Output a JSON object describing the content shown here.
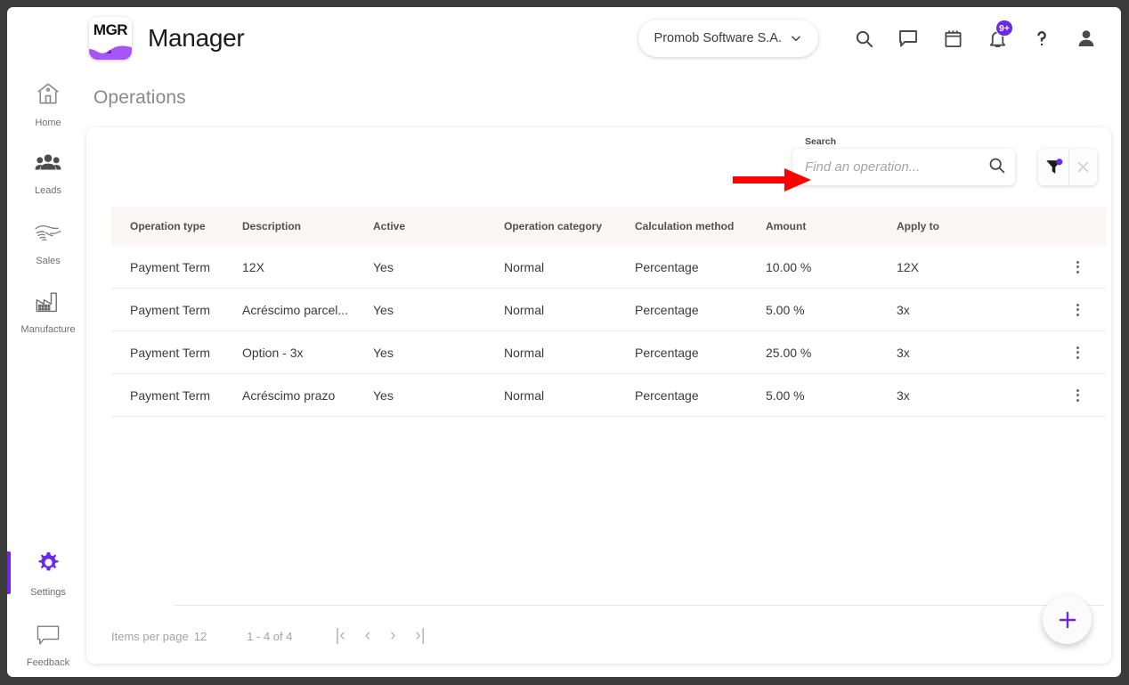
{
  "app": {
    "logo_text": "MGR",
    "title": "Manager"
  },
  "header": {
    "company": "Promob Software S.A.",
    "icons": [
      {
        "name": "search-icon",
        "label": "Search"
      },
      {
        "name": "chat-icon",
        "label": "Messages"
      },
      {
        "name": "calendar-icon",
        "label": "Calendar"
      },
      {
        "name": "bell-icon",
        "label": "Notifications",
        "badge": "9+"
      },
      {
        "name": "help-icon",
        "label": "Help"
      },
      {
        "name": "user-icon",
        "label": "Account"
      }
    ],
    "notification_badge": "9+"
  },
  "sidebar": {
    "items": [
      {
        "label": "Home",
        "icon": "home-icon",
        "active": false
      },
      {
        "label": "Leads",
        "icon": "people-icon",
        "active": false
      },
      {
        "label": "Sales",
        "icon": "handshake-icon",
        "active": false
      },
      {
        "label": "Manufacture",
        "icon": "factory-icon",
        "active": false
      },
      {
        "label": "Settings",
        "icon": "gear-icon",
        "active": true
      },
      {
        "label": "Feedback",
        "icon": "chat-bubble-icon",
        "active": false
      }
    ]
  },
  "page": {
    "title": "Operations"
  },
  "search": {
    "label": "Search",
    "placeholder": "Find an operation...",
    "value": ""
  },
  "filter": {
    "filter_icon": "funnel-icon",
    "has_active_filter": true,
    "clear_label": "×"
  },
  "table": {
    "columns": [
      "Operation type",
      "Description",
      "Active",
      "Operation category",
      "Calculation method",
      "Amount",
      "Apply to"
    ],
    "rows": [
      {
        "operation_type": "Payment Term",
        "description": "12X",
        "active": "Yes",
        "operation_category": "Normal",
        "calculation_method": "Percentage",
        "amount": "10.00 %",
        "apply_to": "12X"
      },
      {
        "operation_type": "Payment Term",
        "description": "Acréscimo parcel...",
        "active": "Yes",
        "operation_category": "Normal",
        "calculation_method": "Percentage",
        "amount": "5.00 %",
        "apply_to": "3x"
      },
      {
        "operation_type": "Payment Term",
        "description": "Option - 3x",
        "active": "Yes",
        "operation_category": "Normal",
        "calculation_method": "Percentage",
        "amount": "25.00 %",
        "apply_to": "3x"
      },
      {
        "operation_type": "Payment Term",
        "description": "Acréscimo prazo",
        "active": "Yes",
        "operation_category": "Normal",
        "calculation_method": "Percentage",
        "amount": "5.00 %",
        "apply_to": "3x"
      }
    ]
  },
  "pagination": {
    "items_per_page_label": "Items per page",
    "items_per_page_value": "12",
    "range": "1 - 4 of 4",
    "first_label": "|‹",
    "prev_label": "‹",
    "next_label": "›",
    "last_label": "›|"
  },
  "fab": {
    "label": "+"
  },
  "colors": {
    "accent_purple": "#6b28e8",
    "header_bg": "#faf7f5",
    "annotation_red": "#ff0000",
    "frame_dark": "#3b3b3b"
  }
}
